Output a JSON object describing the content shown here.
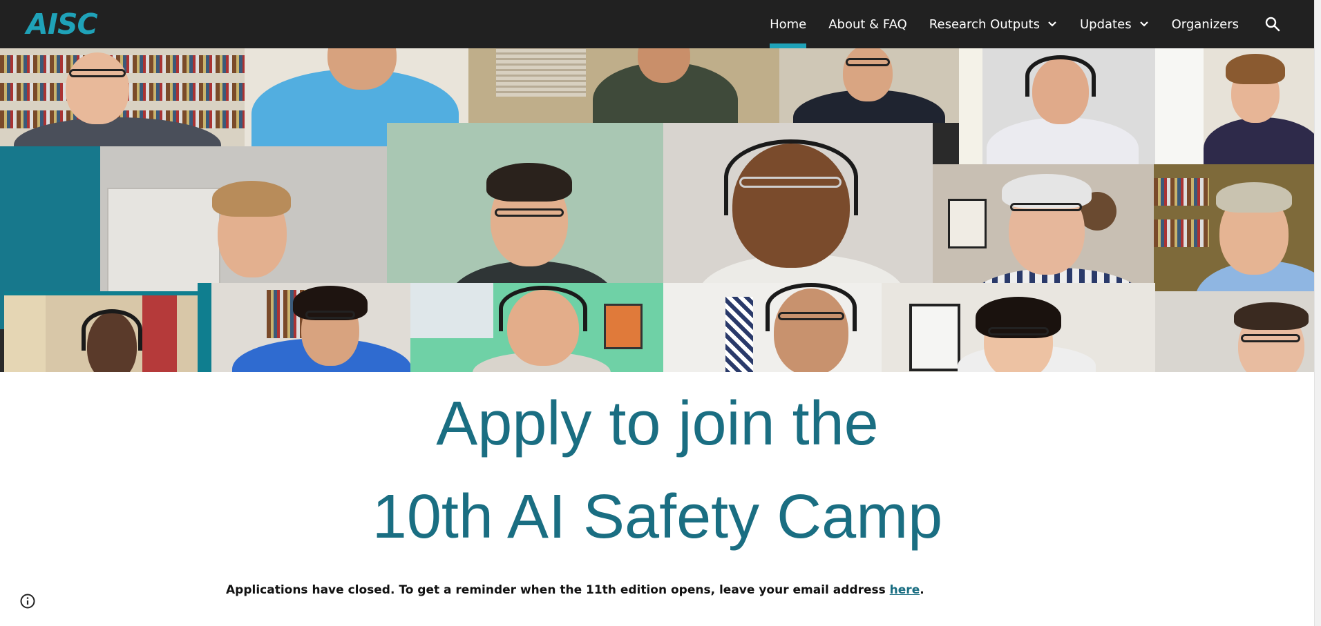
{
  "site": {
    "logo_text": "AISC",
    "brand_color": "#1fa2b8",
    "heading_color": "#1a6e82"
  },
  "nav": {
    "items": [
      {
        "label": "Home",
        "active": true,
        "has_dropdown": false
      },
      {
        "label": "About & FAQ",
        "active": false,
        "has_dropdown": false
      },
      {
        "label": "Research Outputs",
        "active": false,
        "has_dropdown": true
      },
      {
        "label": "Updates",
        "active": false,
        "has_dropdown": true
      },
      {
        "label": "Organizers",
        "active": false,
        "has_dropdown": false
      }
    ],
    "search_icon": "search-icon"
  },
  "hero": {
    "image": "video-call-collage"
  },
  "headline": {
    "line1": "Apply to join the",
    "line2": "10th AI Safety Camp"
  },
  "notice": {
    "text_before": "Applications have closed. To get a reminder when the 11th edition opens, leave your email address ",
    "link_text": "here",
    "text_after": "."
  },
  "footer": {
    "info_icon": "info-icon"
  }
}
